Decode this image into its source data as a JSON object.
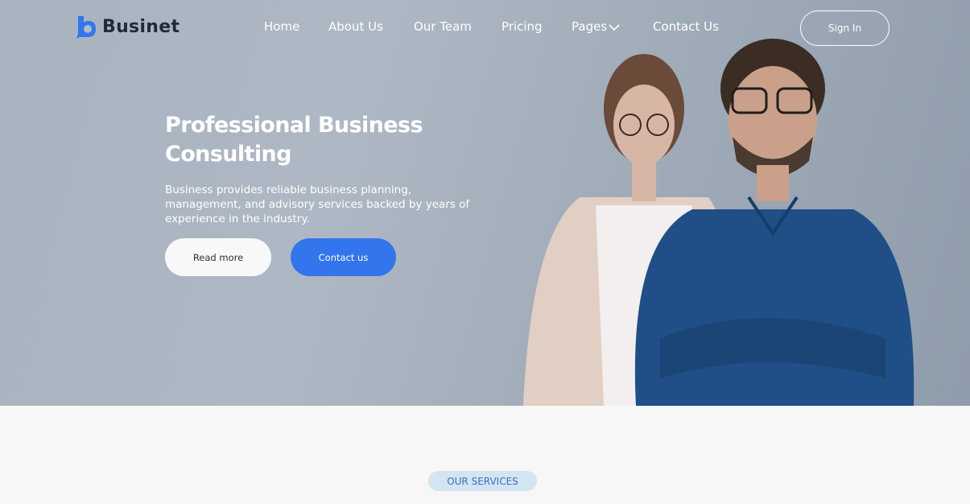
{
  "brand": {
    "name": "Businet",
    "accent": "#3375ec"
  },
  "nav": {
    "items": [
      {
        "label": "Home"
      },
      {
        "label": "About Us"
      },
      {
        "label": "Our Team"
      },
      {
        "label": "Pricing"
      },
      {
        "label": "Pages",
        "has_dropdown": true
      },
      {
        "label": "Contact Us"
      }
    ],
    "signin_label": "Sign In"
  },
  "hero": {
    "title": "Professional Business Consulting",
    "description": "Business provides reliable business planning, management, and advisory services backed by years of experience in the industry.",
    "read_more_label": "Read more",
    "contact_label": "Contact us"
  },
  "services": {
    "badge": "OUR SERVICES"
  }
}
